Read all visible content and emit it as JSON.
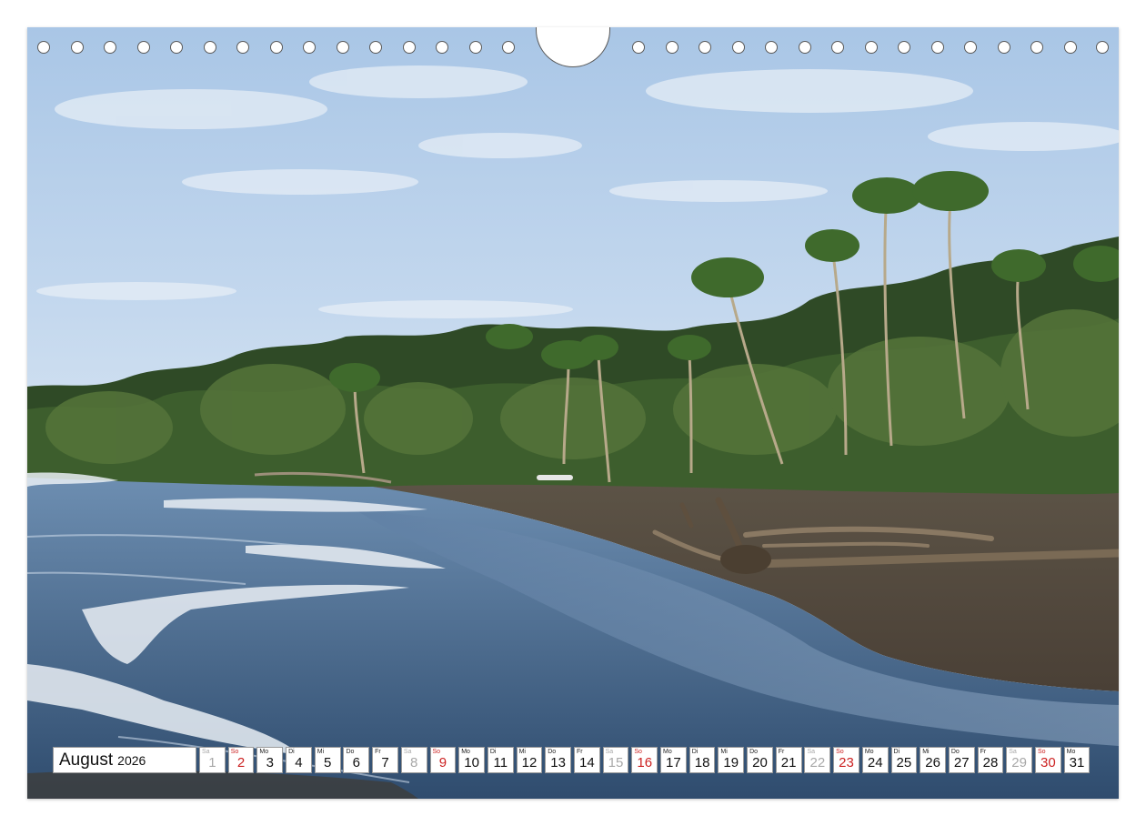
{
  "calendar": {
    "month": "August",
    "year": "2026",
    "days": [
      {
        "wd": "Sa",
        "d": "1",
        "type": "sat"
      },
      {
        "wd": "So",
        "d": "2",
        "type": "sun"
      },
      {
        "wd": "Mo",
        "d": "3",
        "type": "work"
      },
      {
        "wd": "Di",
        "d": "4",
        "type": "work"
      },
      {
        "wd": "Mi",
        "d": "5",
        "type": "work"
      },
      {
        "wd": "Do",
        "d": "6",
        "type": "work"
      },
      {
        "wd": "Fr",
        "d": "7",
        "type": "work"
      },
      {
        "wd": "Sa",
        "d": "8",
        "type": "sat"
      },
      {
        "wd": "So",
        "d": "9",
        "type": "sun"
      },
      {
        "wd": "Mo",
        "d": "10",
        "type": "work"
      },
      {
        "wd": "Di",
        "d": "11",
        "type": "work"
      },
      {
        "wd": "Mi",
        "d": "12",
        "type": "work"
      },
      {
        "wd": "Do",
        "d": "13",
        "type": "work"
      },
      {
        "wd": "Fr",
        "d": "14",
        "type": "work"
      },
      {
        "wd": "Sa",
        "d": "15",
        "type": "sat"
      },
      {
        "wd": "So",
        "d": "16",
        "type": "sun"
      },
      {
        "wd": "Mo",
        "d": "17",
        "type": "work"
      },
      {
        "wd": "Di",
        "d": "18",
        "type": "work"
      },
      {
        "wd": "Mi",
        "d": "19",
        "type": "work"
      },
      {
        "wd": "Do",
        "d": "20",
        "type": "work"
      },
      {
        "wd": "Fr",
        "d": "21",
        "type": "work"
      },
      {
        "wd": "Sa",
        "d": "22",
        "type": "sat"
      },
      {
        "wd": "So",
        "d": "23",
        "type": "sun"
      },
      {
        "wd": "Mo",
        "d": "24",
        "type": "work"
      },
      {
        "wd": "Di",
        "d": "25",
        "type": "work"
      },
      {
        "wd": "Mi",
        "d": "26",
        "type": "work"
      },
      {
        "wd": "Do",
        "d": "27",
        "type": "work"
      },
      {
        "wd": "Fr",
        "d": "28",
        "type": "work"
      },
      {
        "wd": "Sa",
        "d": "29",
        "type": "sat"
      },
      {
        "wd": "So",
        "d": "30",
        "type": "sun"
      },
      {
        "wd": "Mo",
        "d": "31",
        "type": "work"
      }
    ]
  },
  "colors": {
    "sunday": "#cc2222",
    "saturday": "#a8a8a8",
    "weekday": "#111111"
  }
}
